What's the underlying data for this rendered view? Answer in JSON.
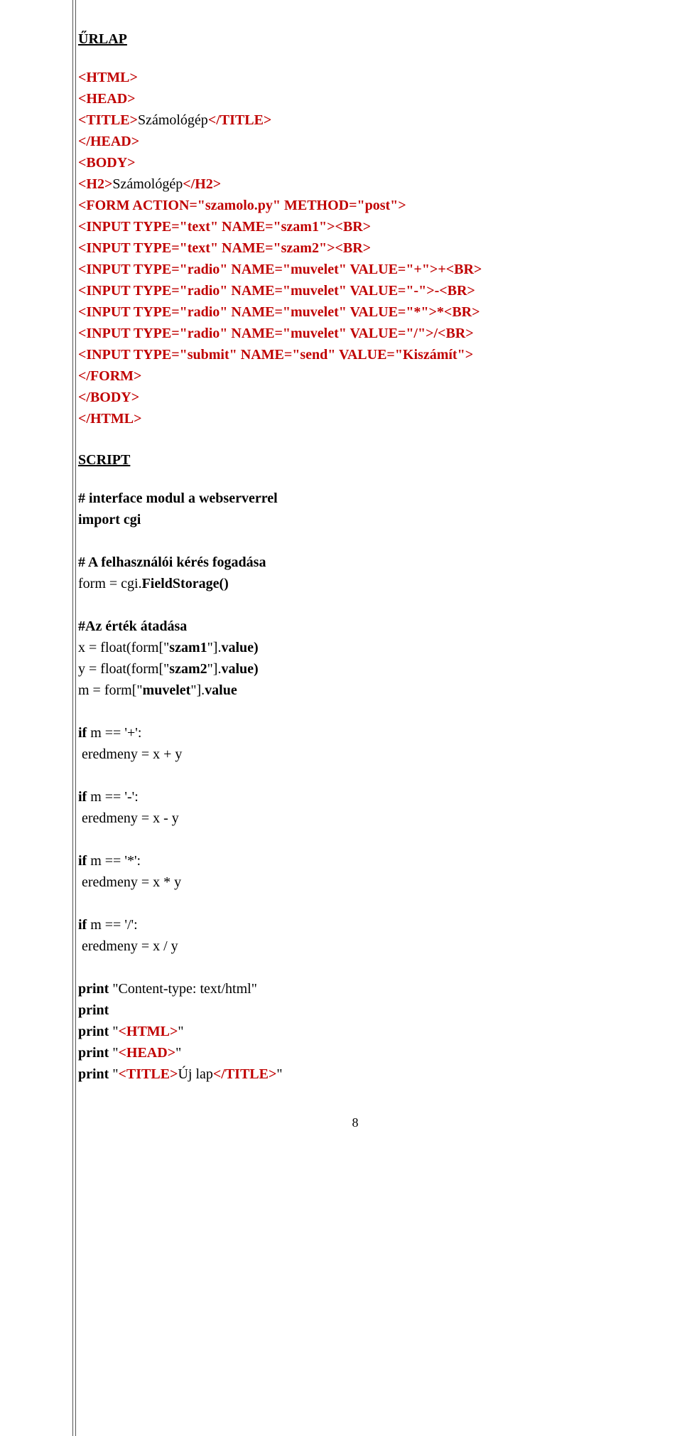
{
  "headings": {
    "urlap": "ŰRLAP",
    "script": "SCRIPT"
  },
  "html_block": {
    "l1": "<HTML>",
    "l2": "<HEAD>",
    "l3a": "<TITLE>",
    "l3b": "Számológép",
    "l3c": "</TITLE>",
    "l4": "</HEAD>",
    "l5": "<BODY>",
    "l6a": "<H2>",
    "l6b": "Számológép",
    "l6c": "</H2>",
    "l7": "<FORM ACTION=\"szamolo.py\" METHOD=\"post\">",
    "l8": "<INPUT TYPE=\"text\" NAME=\"szam1\"><BR>",
    "l9": "<INPUT TYPE=\"text\" NAME=\"szam2\"><BR>",
    "l10": "<INPUT TYPE=\"radio\" NAME=\"muvelet\" VALUE=\"+\">+<BR>",
    "l11": "<INPUT TYPE=\"radio\" NAME=\"muvelet\" VALUE=\"-\">-<BR>",
    "l12": "<INPUT TYPE=\"radio\" NAME=\"muvelet\" VALUE=\"*\">*<BR>",
    "l13": "<INPUT TYPE=\"radio\" NAME=\"muvelet\" VALUE=\"/\">/<BR>",
    "l14": "<INPUT TYPE=\"submit\" NAME=\"send\" VALUE=\"Kiszámít\">",
    "l15": "</FORM>",
    "l16": "</BODY>",
    "l17": "</HTML>"
  },
  "script_block": {
    "s1": "# interface modul a webserverrel",
    "s2": "import cgi",
    "s3": "# A felhasználói kérés fogadása",
    "s4a": "form = cgi.",
    "s4b": "FieldStorage()",
    "s5": "#Az érték átadása",
    "s6a": "x = float(form[\"",
    "s6b": "szam1",
    "s6c": "\"].",
    "s6d": "value)",
    "s7a": "y = float(form[\"",
    "s7b": "szam2",
    "s7c": "\"].",
    "s7d": "value)",
    "s8a": "m = form[\"",
    "s8b": "muvelet",
    "s8c": "\"].",
    "s8d": "value",
    "s9": "if",
    "s9b": " m == '+':",
    "s10": " eredmeny = x + y",
    "s11": "if",
    "s11b": " m == '-':",
    "s12": " eredmeny = x - y",
    "s13": "if",
    "s13b": " m == '*':",
    "s14": " eredmeny = x * y",
    "s15": "if",
    "s15b": " m == '/':",
    "s16": " eredmeny = x / y",
    "s17": "print",
    "s17b": " \"Content-type: text/html\"",
    "s18": "print",
    "s19": "print",
    "s19b": " \"",
    "s19c": "<HTML>",
    "s19d": "\"",
    "s20": "print",
    "s20b": " \"",
    "s20c": "<HEAD>",
    "s20d": "\"",
    "s21": "print",
    "s21b": " \"",
    "s21c": "<TITLE>",
    "s21d": "Új lap",
    "s21e": "</TITLE>",
    "s21f": "\""
  },
  "page_number": "8"
}
